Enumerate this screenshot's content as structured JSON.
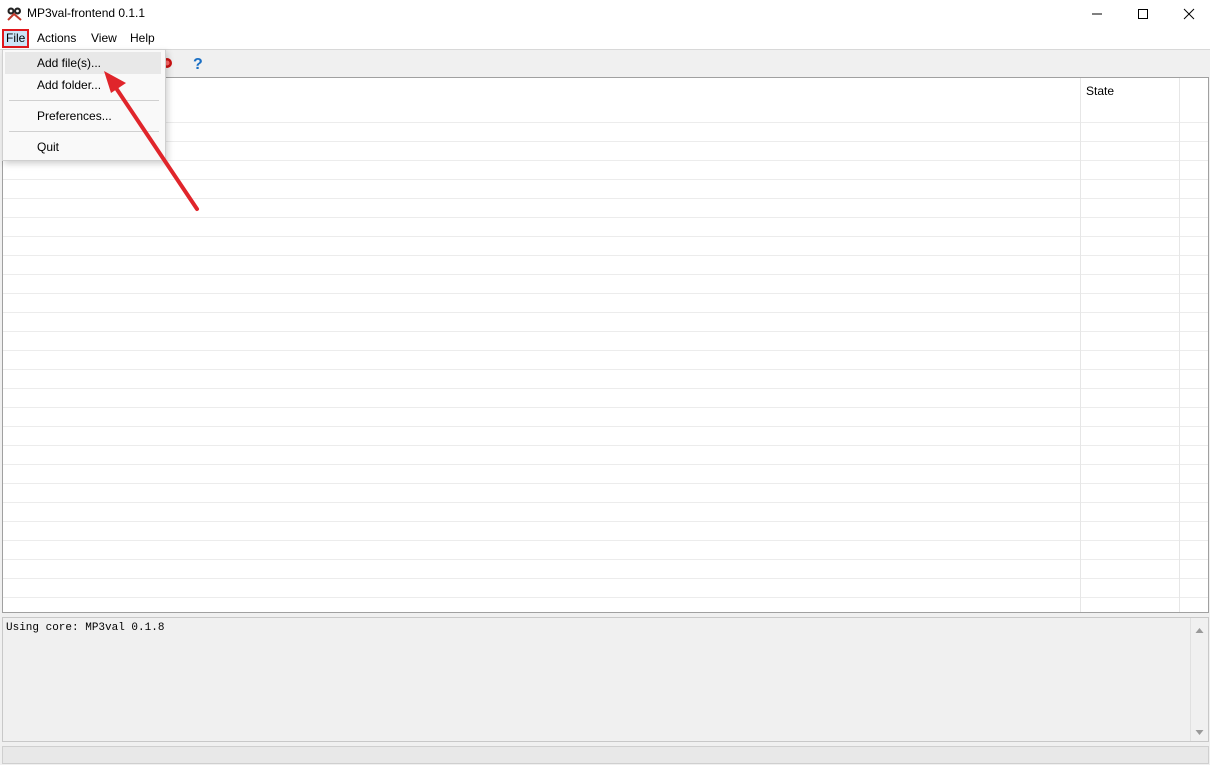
{
  "window": {
    "title": "MP3val-frontend 0.1.1",
    "minimize_icon": "minimize-icon",
    "maximize_icon": "maximize-icon",
    "close_icon": "close-icon"
  },
  "menubar": {
    "items": [
      {
        "label": "File",
        "active": true
      },
      {
        "label": "Actions"
      },
      {
        "label": "View"
      },
      {
        "label": "Help"
      }
    ]
  },
  "toolbar": {
    "icons": [
      "stop-icon",
      "help-icon"
    ]
  },
  "file_menu": {
    "items": [
      {
        "label": "Add file(s)...",
        "highlighted": true
      },
      {
        "label": "Add folder..."
      },
      {
        "label": "Preferences..."
      },
      {
        "label": "Quit"
      }
    ]
  },
  "filelist": {
    "columns": [
      "State"
    ],
    "rows": []
  },
  "log": {
    "text": "Using core: MP3val 0.1.8"
  },
  "colors": {
    "highlight_box": "#e0171c",
    "annotation_arrow": "#e0252b"
  }
}
